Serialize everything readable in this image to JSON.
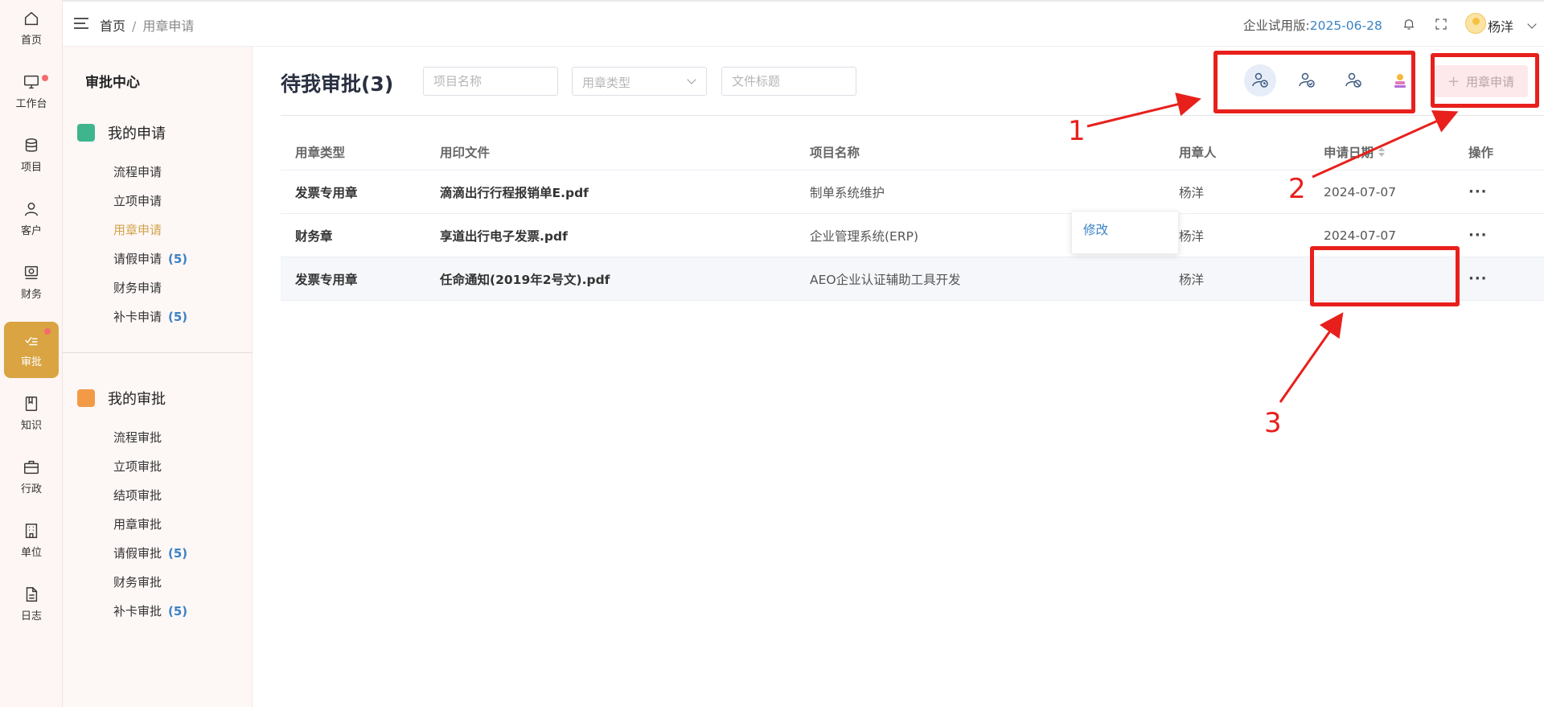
{
  "rail": {
    "items": [
      {
        "label": "首页",
        "icon": "home-icon"
      },
      {
        "label": "工作台",
        "icon": "monitor-icon",
        "dot": true
      },
      {
        "label": "项目",
        "icon": "database-icon"
      },
      {
        "label": "客户",
        "icon": "user-icon"
      },
      {
        "label": "财务",
        "icon": "finance-icon"
      },
      {
        "label": "审批",
        "icon": "approval-icon",
        "dot": true,
        "active": true
      },
      {
        "label": "知识",
        "icon": "book-icon"
      },
      {
        "label": "行政",
        "icon": "briefcase-icon"
      },
      {
        "label": "单位",
        "icon": "building-icon"
      },
      {
        "label": "日志",
        "icon": "document-icon"
      }
    ]
  },
  "header": {
    "breadcrumb": {
      "home": "首页",
      "separator": "/",
      "current": "用章申请"
    },
    "trial_label": "企业试用版:",
    "trial_date": "2025-06-28",
    "username": "杨洋"
  },
  "subnav": {
    "title": "审批中心",
    "my_applications": {
      "label": "我的申请",
      "items": [
        {
          "label": "流程申请"
        },
        {
          "label": "立项申请"
        },
        {
          "label": "用章申请",
          "active": true
        },
        {
          "label": "请假申请",
          "count": "(5)"
        },
        {
          "label": "财务申请"
        },
        {
          "label": "补卡申请",
          "count": "(5)"
        }
      ]
    },
    "my_approvals": {
      "label": "我的审批",
      "items": [
        {
          "label": "流程审批"
        },
        {
          "label": "立项审批"
        },
        {
          "label": "结项审批"
        },
        {
          "label": "用章审批"
        },
        {
          "label": "请假审批",
          "count": "(5)"
        },
        {
          "label": "财务审批"
        },
        {
          "label": "补卡审批",
          "count": "(5)"
        }
      ]
    }
  },
  "main": {
    "title": "待我审批(3)",
    "filters": {
      "project_placeholder": "项目名称",
      "seal_type_placeholder": "用章类型",
      "doc_title_placeholder": "文件标题"
    },
    "add_button": "用章申请",
    "table": {
      "columns": [
        "用章类型",
        "用印文件",
        "项目名称",
        "用章人",
        "申请日期",
        "操作"
      ],
      "rows": [
        {
          "seal_type": "发票专用章",
          "file": "滴滴出行行程报销单E.pdf",
          "project": "制单系统维护",
          "user": "杨洋",
          "date": "2024-07-07",
          "action": "···"
        },
        {
          "seal_type": "财务章",
          "file": "享道出行电子发票.pdf",
          "project": "企业管理系统(ERP)",
          "user": "杨洋",
          "date": "2024-07-07",
          "action": "···"
        },
        {
          "seal_type": "发票专用章",
          "file": "任命通知(2019年2号文).pdf",
          "project": "AEO企业认证辅助工具开发",
          "user": "杨洋",
          "date": "",
          "action": "···"
        }
      ]
    },
    "dropdown_option": "修改"
  },
  "annotations": [
    "1",
    "2",
    "3"
  ],
  "colors": {
    "accent": "#d9a441",
    "link": "#3b82c4",
    "annotation": "#e8201c"
  }
}
